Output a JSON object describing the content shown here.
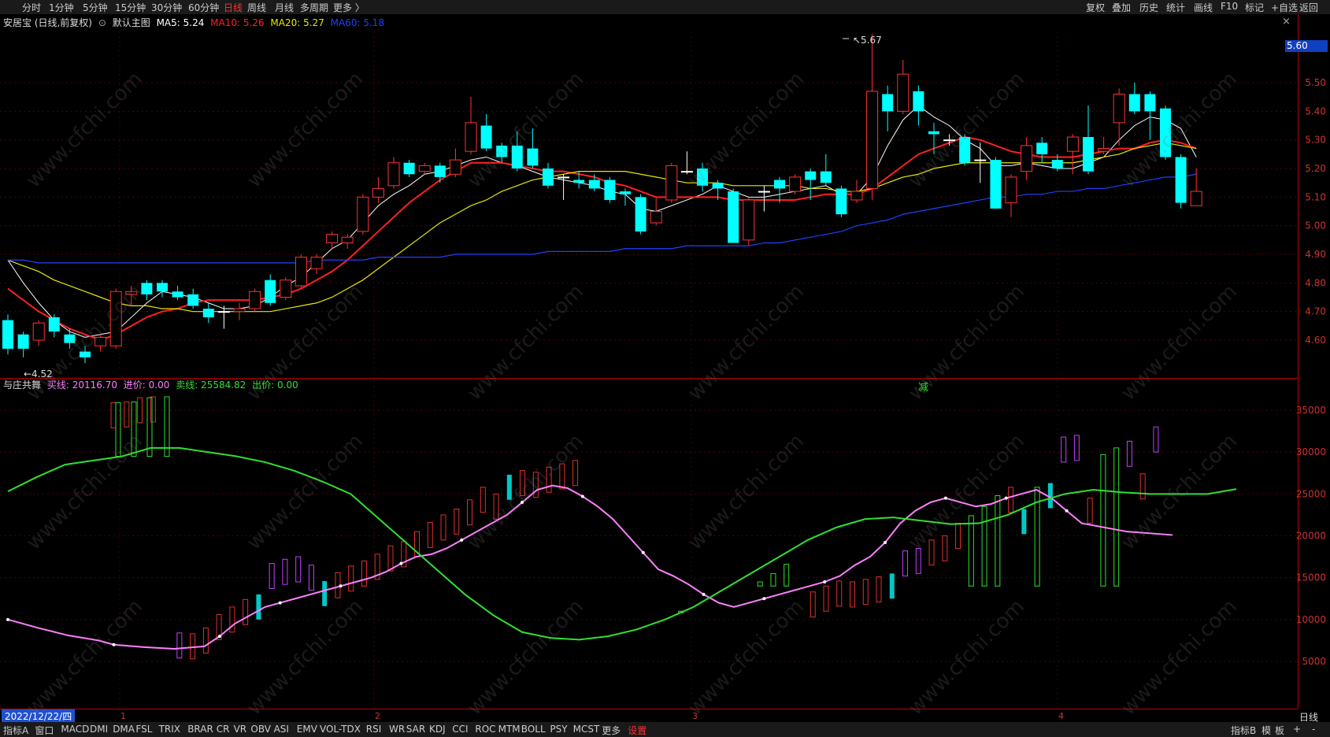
{
  "topbar": {
    "left": [
      "分时",
      "1分钟",
      "5分钟",
      "15分钟",
      "30分钟",
      "60分钟",
      "日线",
      "周线",
      "月线",
      "多周期",
      "更多 〉"
    ],
    "active": "日线",
    "right": [
      "复权",
      "叠加",
      "历史",
      "统计",
      "画线",
      "F10",
      "标记",
      "+自选",
      "返回"
    ]
  },
  "info": {
    "stock": "安居宝 (日线,前复权)",
    "theme": "默认主图",
    "ma5": "MA5: 5.24",
    "ma10": "MA10: 5.26",
    "ma20": "MA20: 5.27",
    "ma60": "MA60: 5.18"
  },
  "indicator": {
    "name": "与庄共舞",
    "buy": "买线: 20116.70",
    "in": "进价: 0.00",
    "sell": "卖线: 25584.82",
    "out": "出价: 0.00"
  },
  "annotations": {
    "high": "5.67",
    "low": "4.52",
    "marker": "减",
    "price_tag": "5.60"
  },
  "dates": {
    "current": "2022/12/22/四",
    "months": [
      "1",
      "2",
      "3",
      "4"
    ]
  },
  "period_label": "日线",
  "close_icon": "×",
  "bottombar": {
    "left": [
      "指标A",
      "窗口",
      "MACD",
      "DMI",
      "DMA",
      "FSL",
      "TRIX",
      "BRAR",
      "CR",
      "VR",
      "OBV",
      "ASI",
      "EMV",
      "VOL-TDX",
      "RSI",
      "WR",
      "SAR",
      "KDJ",
      "CCI",
      "ROC",
      "MTM",
      "BOLL",
      "PSY",
      "MCST",
      "更多",
      "设置"
    ],
    "right": [
      "指标B",
      "模",
      "板",
      "+",
      "-"
    ]
  },
  "colors": {
    "up": "#ff3232",
    "down": "#00ffff",
    "ma5": "#ffffff",
    "ma10": "#ff2020",
    "ma20": "#e8e800",
    "ma60": "#2040ff",
    "buyline": "#ff80ff",
    "sellline": "#30e030"
  },
  "chart_data": [
    {
      "type": "candlestick",
      "title": "安居宝 (日线,前复权)",
      "y_ticks": [
        4.6,
        4.7,
        4.8,
        4.9,
        5.0,
        5.1,
        5.2,
        5.3,
        5.4,
        5.5
      ],
      "ylim": [
        4.48,
        5.72
      ],
      "candles": [
        [
          4.67,
          4.57,
          4.69,
          4.55
        ],
        [
          4.62,
          4.57,
          4.63,
          4.54
        ],
        [
          4.6,
          4.66,
          4.67,
          4.58
        ],
        [
          4.68,
          4.63,
          4.69,
          4.61
        ],
        [
          4.62,
          4.59,
          4.64,
          4.57
        ],
        [
          4.56,
          4.54,
          4.58,
          4.52
        ],
        [
          4.58,
          4.61,
          4.62,
          4.56
        ],
        [
          4.58,
          4.77,
          4.78,
          4.57
        ],
        [
          4.76,
          4.77,
          4.79,
          4.72
        ],
        [
          4.8,
          4.76,
          4.81,
          4.74
        ],
        [
          4.8,
          4.77,
          4.81,
          4.75
        ],
        [
          4.77,
          4.75,
          4.79,
          4.74
        ],
        [
          4.76,
          4.72,
          4.78,
          4.71
        ],
        [
          4.71,
          4.68,
          4.73,
          4.66
        ],
        [
          4.7,
          4.7,
          4.72,
          4.64
        ],
        [
          4.7,
          4.71,
          4.73,
          4.67
        ],
        [
          4.71,
          4.77,
          4.78,
          4.7
        ],
        [
          4.81,
          4.73,
          4.83,
          4.72
        ],
        [
          4.75,
          4.81,
          4.82,
          4.74
        ],
        [
          4.79,
          4.89,
          4.9,
          4.78
        ],
        [
          4.85,
          4.89,
          4.9,
          4.83
        ],
        [
          4.94,
          4.97,
          4.98,
          4.92
        ],
        [
          4.94,
          4.96,
          4.97,
          4.92
        ],
        [
          4.98,
          5.1,
          5.11,
          4.97
        ],
        [
          5.1,
          5.13,
          5.17,
          5.08
        ],
        [
          5.14,
          5.22,
          5.24,
          5.13
        ],
        [
          5.22,
          5.18,
          5.23,
          5.17
        ],
        [
          5.19,
          5.21,
          5.22,
          5.18
        ],
        [
          5.21,
          5.17,
          5.22,
          5.15
        ],
        [
          5.18,
          5.23,
          5.27,
          5.17
        ],
        [
          5.26,
          5.36,
          5.45,
          5.25
        ],
        [
          5.35,
          5.27,
          5.39,
          5.26
        ],
        [
          5.28,
          5.24,
          5.29,
          5.22
        ],
        [
          5.28,
          5.2,
          5.33,
          5.19
        ],
        [
          5.27,
          5.21,
          5.34,
          5.2
        ],
        [
          5.2,
          5.14,
          5.22,
          5.13
        ],
        [
          5.17,
          5.17,
          5.18,
          5.09
        ],
        [
          5.16,
          5.15,
          5.19,
          5.13
        ],
        [
          5.16,
          5.13,
          5.18,
          5.12
        ],
        [
          5.16,
          5.09,
          5.17,
          5.08
        ],
        [
          5.12,
          5.11,
          5.13,
          5.07
        ],
        [
          5.1,
          4.98,
          5.11,
          4.97
        ],
        [
          5.01,
          5.05,
          5.1,
          5.0
        ],
        [
          5.09,
          5.21,
          5.22,
          5.08
        ],
        [
          5.19,
          5.19,
          5.26,
          5.18
        ],
        [
          5.2,
          5.14,
          5.22,
          5.12
        ],
        [
          5.15,
          5.13,
          5.16,
          5.09
        ],
        [
          5.12,
          4.94,
          5.13,
          4.94
        ],
        [
          4.95,
          5.09,
          5.1,
          4.93
        ],
        [
          5.12,
          5.12,
          5.14,
          5.05
        ],
        [
          5.16,
          5.13,
          5.17,
          5.08
        ],
        [
          5.12,
          5.17,
          5.18,
          5.11
        ],
        [
          5.19,
          5.16,
          5.2,
          5.09
        ],
        [
          5.19,
          5.15,
          5.25,
          5.14
        ],
        [
          5.13,
          5.04,
          5.14,
          5.03
        ],
        [
          5.09,
          5.12,
          5.16,
          5.08
        ],
        [
          5.13,
          5.47,
          5.67,
          5.09
        ],
        [
          5.46,
          5.4,
          5.49,
          5.33
        ],
        [
          5.4,
          5.53,
          5.58,
          5.39
        ],
        [
          5.47,
          5.4,
          5.49,
          5.35
        ],
        [
          5.33,
          5.32,
          5.36,
          5.25
        ],
        [
          5.3,
          5.3,
          5.32,
          5.28
        ],
        [
          5.31,
          5.22,
          5.32,
          5.21
        ],
        [
          5.23,
          5.23,
          5.29,
          5.15
        ],
        [
          5.23,
          5.06,
          5.24,
          5.06
        ],
        [
          5.08,
          5.17,
          5.18,
          5.03
        ],
        [
          5.19,
          5.28,
          5.31,
          5.16
        ],
        [
          5.29,
          5.25,
          5.31,
          5.22
        ],
        [
          5.23,
          5.2,
          5.25,
          5.19
        ],
        [
          5.26,
          5.31,
          5.32,
          5.18
        ],
        [
          5.31,
          5.19,
          5.42,
          5.18
        ],
        [
          5.26,
          5.27,
          5.31,
          5.25
        ],
        [
          5.36,
          5.46,
          5.48,
          5.28
        ],
        [
          5.46,
          5.4,
          5.5,
          5.39
        ],
        [
          5.46,
          5.4,
          5.47,
          5.3
        ],
        [
          5.41,
          5.24,
          5.42,
          5.23
        ],
        [
          5.24,
          5.08,
          5.25,
          5.06
        ],
        [
          5.07,
          5.12,
          5.2,
          5.07
        ]
      ],
      "ma": {
        "MA5": [
          4.88,
          4.8,
          4.73,
          4.67,
          4.63,
          4.61,
          4.62,
          4.63,
          4.68,
          4.73,
          4.77,
          4.76,
          4.75,
          4.73,
          4.71,
          4.71,
          4.72,
          4.75,
          4.79,
          4.82,
          4.87,
          4.92,
          4.95,
          5.01,
          5.07,
          5.11,
          5.14,
          5.18,
          5.19,
          5.21,
          5.23,
          5.24,
          5.22,
          5.21,
          5.19,
          5.17,
          5.16,
          5.15,
          5.14,
          5.12,
          5.11,
          5.06,
          5.05,
          5.07,
          5.09,
          5.11,
          5.14,
          5.12,
          5.1,
          5.1,
          5.11,
          5.12,
          5.13,
          5.14,
          5.11,
          5.11,
          5.17,
          5.28,
          5.37,
          5.42,
          5.38,
          5.35,
          5.3,
          5.27,
          5.21,
          5.21,
          5.22,
          5.21,
          5.2,
          5.2,
          5.22,
          5.24,
          5.3,
          5.35,
          5.38,
          5.37,
          5.34,
          5.24
        ],
        "MA10": [
          4.78,
          4.74,
          4.7,
          4.67,
          4.64,
          4.62,
          4.6,
          4.62,
          4.65,
          4.68,
          4.7,
          4.71,
          4.73,
          4.74,
          4.74,
          4.74,
          4.74,
          4.75,
          4.76,
          4.78,
          4.81,
          4.84,
          4.88,
          4.93,
          4.98,
          5.03,
          5.08,
          5.12,
          5.16,
          5.19,
          5.22,
          5.22,
          5.22,
          5.21,
          5.2,
          5.19,
          5.19,
          5.18,
          5.17,
          5.15,
          5.14,
          5.12,
          5.1,
          5.1,
          5.1,
          5.1,
          5.1,
          5.09,
          5.09,
          5.09,
          5.09,
          5.09,
          5.1,
          5.11,
          5.11,
          5.11,
          5.13,
          5.17,
          5.21,
          5.25,
          5.27,
          5.29,
          5.31,
          5.3,
          5.28,
          5.26,
          5.25,
          5.24,
          5.24,
          5.24,
          5.25,
          5.26,
          5.27,
          5.27,
          5.29,
          5.3,
          5.29,
          5.27
        ],
        "MA20": [
          4.88,
          4.86,
          4.84,
          4.81,
          4.79,
          4.77,
          4.75,
          4.73,
          4.72,
          4.72,
          4.71,
          4.71,
          4.7,
          4.7,
          4.7,
          4.7,
          4.7,
          4.7,
          4.71,
          4.72,
          4.73,
          4.75,
          4.78,
          4.81,
          4.85,
          4.89,
          4.93,
          4.97,
          5.01,
          5.04,
          5.07,
          5.09,
          5.12,
          5.14,
          5.16,
          5.17,
          5.18,
          5.19,
          5.19,
          5.19,
          5.19,
          5.18,
          5.17,
          5.16,
          5.15,
          5.15,
          5.15,
          5.14,
          5.14,
          5.14,
          5.14,
          5.14,
          5.13,
          5.13,
          5.12,
          5.12,
          5.13,
          5.15,
          5.17,
          5.18,
          5.2,
          5.21,
          5.22,
          5.22,
          5.22,
          5.22,
          5.22,
          5.22,
          5.22,
          5.22,
          5.23,
          5.24,
          5.25,
          5.27,
          5.28,
          5.29,
          5.28,
          5.27
        ],
        "MA60": [
          4.88,
          4.88,
          4.87,
          4.87,
          4.87,
          4.87,
          4.87,
          4.87,
          4.87,
          4.87,
          4.87,
          4.87,
          4.87,
          4.87,
          4.87,
          4.87,
          4.87,
          4.87,
          4.87,
          4.87,
          4.88,
          4.88,
          4.88,
          4.88,
          4.89,
          4.89,
          4.89,
          4.89,
          4.89,
          4.9,
          4.9,
          4.9,
          4.9,
          4.9,
          4.9,
          4.91,
          4.91,
          4.91,
          4.91,
          4.91,
          4.92,
          4.92,
          4.92,
          4.92,
          4.93,
          4.93,
          4.93,
          4.93,
          4.93,
          4.94,
          4.94,
          4.95,
          4.96,
          4.97,
          4.98,
          5.0,
          5.01,
          5.02,
          5.04,
          5.05,
          5.06,
          5.07,
          5.08,
          5.09,
          5.1,
          5.1,
          5.11,
          5.11,
          5.12,
          5.12,
          5.13,
          5.13,
          5.14,
          5.15,
          5.16,
          5.17,
          5.17,
          5.18
        ]
      }
    },
    {
      "type": "line",
      "title": "与庄共舞",
      "y_ticks": [
        5000,
        10000,
        15000,
        20000,
        25000,
        30000,
        35000
      ],
      "ylim": [
        0,
        38500
      ],
      "series": [
        {
          "name": "买线",
          "values": [
            10000,
            9000,
            8100,
            7500,
            7000,
            6700,
            6500,
            6800,
            8000,
            9500,
            10500,
            11500,
            12000,
            12500,
            13000,
            13500,
            14000,
            14500,
            15000,
            15700,
            16700,
            17500,
            17800,
            18500,
            19500,
            20500,
            21500,
            22500,
            24000,
            25500,
            26000,
            25700,
            24700,
            23500,
            22000,
            20000,
            18000,
            16000,
            15200,
            14200,
            13000,
            12000,
            11500,
            12000,
            12500,
            13000,
            13500,
            14000,
            14500,
            15200,
            16500,
            17500,
            19200,
            21500,
            23000,
            24000,
            24500,
            24000,
            23500,
            23800,
            24500,
            25000,
            25500,
            24500,
            23000,
            21500,
            20500,
            20100
          ],
          "x_index": [
            0,
            2,
            4,
            6,
            7,
            9,
            11,
            13,
            14,
            15,
            16,
            17,
            18,
            19,
            20,
            21,
            22,
            23,
            24,
            25,
            26,
            27,
            28,
            29,
            30,
            31,
            32,
            33,
            34,
            35,
            36,
            37,
            38,
            39,
            40,
            41,
            42,
            43,
            44,
            45,
            46,
            47,
            48,
            49,
            50,
            51,
            52,
            53,
            54,
            55,
            56,
            57,
            58,
            59,
            60,
            61,
            62,
            63,
            64,
            65,
            66,
            67,
            68,
            69,
            70,
            71,
            74,
            77
          ]
        },
        {
          "name": "卖线",
          "values": [
            25300,
            27000,
            28500,
            29000,
            29500,
            30500,
            30500,
            30000,
            29500,
            28800,
            27800,
            26500,
            25000,
            22000,
            19000,
            16000,
            13000,
            10500,
            8500,
            7800,
            7600,
            8000,
            8800,
            10000,
            11500,
            13500,
            15500,
            17500,
            19500,
            21000,
            22000,
            22200,
            21800,
            21400,
            21500,
            22500,
            24000,
            25000,
            25500,
            25200,
            25000,
            25000,
            25000,
            25584
          ]
        }
      ],
      "bars_note": "colored vertical bars per candle"
    }
  ]
}
